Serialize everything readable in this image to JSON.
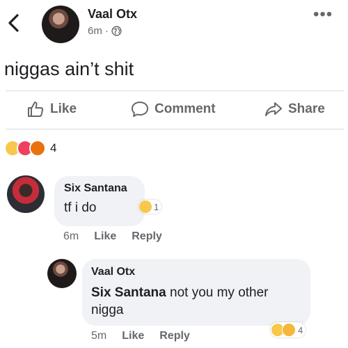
{
  "post": {
    "author": "Vaal Otx",
    "time": "6m",
    "separator": "·",
    "privacy_icon": "globe-icon",
    "text": "niggas ain’t shit",
    "reaction_count": "4",
    "reactions": [
      "haha-reaction-icon",
      "love-reaction-icon",
      "angry-reaction-icon"
    ]
  },
  "actions": {
    "like": "Like",
    "comment": "Comment",
    "share": "Share"
  },
  "comments": [
    {
      "author": "Six Santana",
      "text": "tf i do",
      "time": "6m",
      "like": "Like",
      "reply": "Reply",
      "reaction_count": "1"
    },
    {
      "author": "Vaal Otx",
      "mention": "Six Santana",
      "text_rest": " not you my other nigga",
      "time": "5m",
      "like": "Like",
      "reply": "Reply",
      "reaction_count": "4"
    }
  ],
  "colors": {
    "meta_gray": "#65676b",
    "bubble_bg": "#f0f2f5",
    "divider": "#d8dadf",
    "haha": "#f7c84b",
    "love": "#f0405f",
    "angry": "#e9710f"
  }
}
